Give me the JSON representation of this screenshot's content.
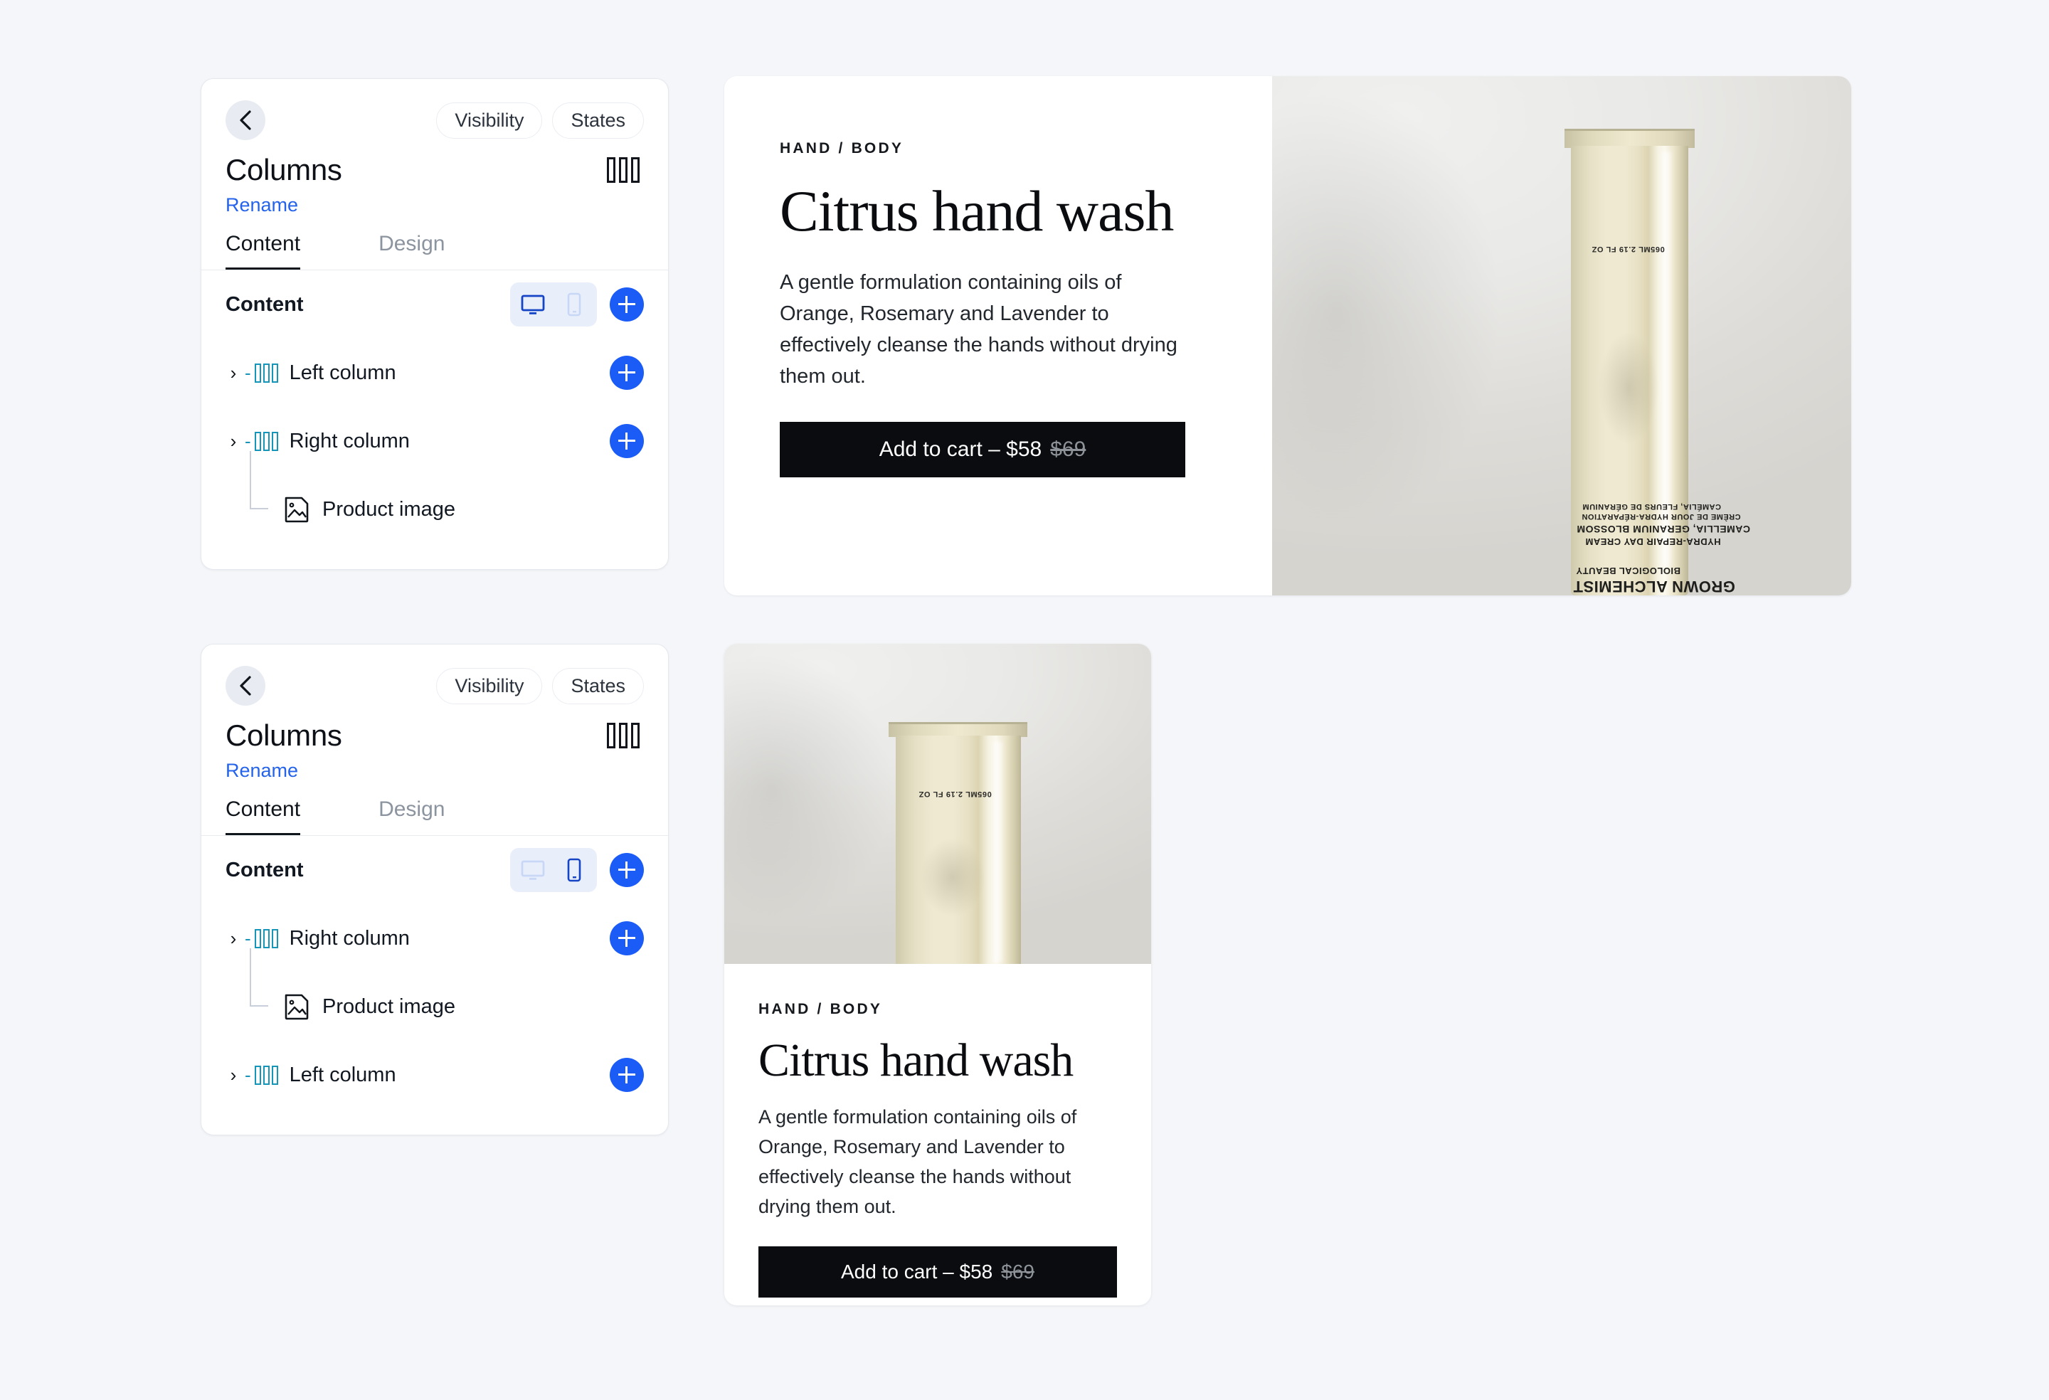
{
  "panels": [
    {
      "back_icon": "chevron-left-icon",
      "visibility_label": "Visibility",
      "states_label": "States",
      "title": "Columns",
      "columns_icon": "columns-icon",
      "rename_label": "Rename",
      "tabs": [
        {
          "label": "Content",
          "active": true
        },
        {
          "label": "Design",
          "active": false
        }
      ],
      "tree_header": {
        "label": "Content",
        "desktop_icon": "monitor-icon",
        "mobile_icon": "phone-icon",
        "active_breakpoint": "desktop",
        "add_icon": "plus-icon"
      },
      "rows": [
        {
          "type": "group",
          "caret": "›",
          "dash": "-",
          "icon": "columns-icon",
          "label": "Left column",
          "add": true
        },
        {
          "type": "group",
          "caret": "›",
          "dash": "-",
          "icon": "columns-icon",
          "label": "Right column",
          "add": true
        },
        {
          "type": "child",
          "icon": "image-icon",
          "label": "Product image",
          "add": false
        }
      ]
    },
    {
      "back_icon": "chevron-left-icon",
      "visibility_label": "Visibility",
      "states_label": "States",
      "title": "Columns",
      "columns_icon": "columns-icon",
      "rename_label": "Rename",
      "tabs": [
        {
          "label": "Content",
          "active": true
        },
        {
          "label": "Design",
          "active": false
        }
      ],
      "tree_header": {
        "label": "Content",
        "desktop_icon": "monitor-icon",
        "mobile_icon": "phone-icon",
        "active_breakpoint": "mobile",
        "add_icon": "plus-icon"
      },
      "rows": [
        {
          "type": "group",
          "caret": "›",
          "dash": "-",
          "icon": "columns-icon",
          "label": "Right column",
          "add": true
        },
        {
          "type": "child",
          "icon": "image-icon",
          "label": "Product image",
          "add": false
        },
        {
          "type": "group",
          "caret": "›",
          "dash": "-",
          "icon": "columns-icon",
          "label": "Left column",
          "add": true
        }
      ]
    }
  ],
  "product": {
    "eyebrow": "HAND / BODY",
    "title": "Citrus hand wash",
    "description": "A gentle formulation containing oils of Orange, Rosemary and Lavender to effectively cleanse the hands without drying them out.",
    "cart_label": "Add to cart – $58",
    "old_price": "$69",
    "image_alt": "product-photo-cosmetic-tube",
    "tube_text": "065ML 2.19 FL OZ",
    "tube_brand": "GROWN ALCHEMIST",
    "tube_brand_sub": "BIOLOGICAL BEAUTY",
    "tube_line1": "HYDRA-REPAIR DAY CREAM",
    "tube_line2": "CAMELLIA, GERANIUM BLOSSOM",
    "tube_line3": "CRÈME DE JOUR HYDRA-RÉPARATION",
    "tube_line4": "CAMÉLIA, FLEURS DE GÉRANIUM"
  },
  "colors": {
    "page_bg": "#f4f6f9",
    "accent_blue": "#1a5cf5",
    "link_blue": "#2463ea",
    "column_icon": "#1596b8",
    "selected_icon": "#1545c4",
    "button_black": "#0a0c0f"
  }
}
